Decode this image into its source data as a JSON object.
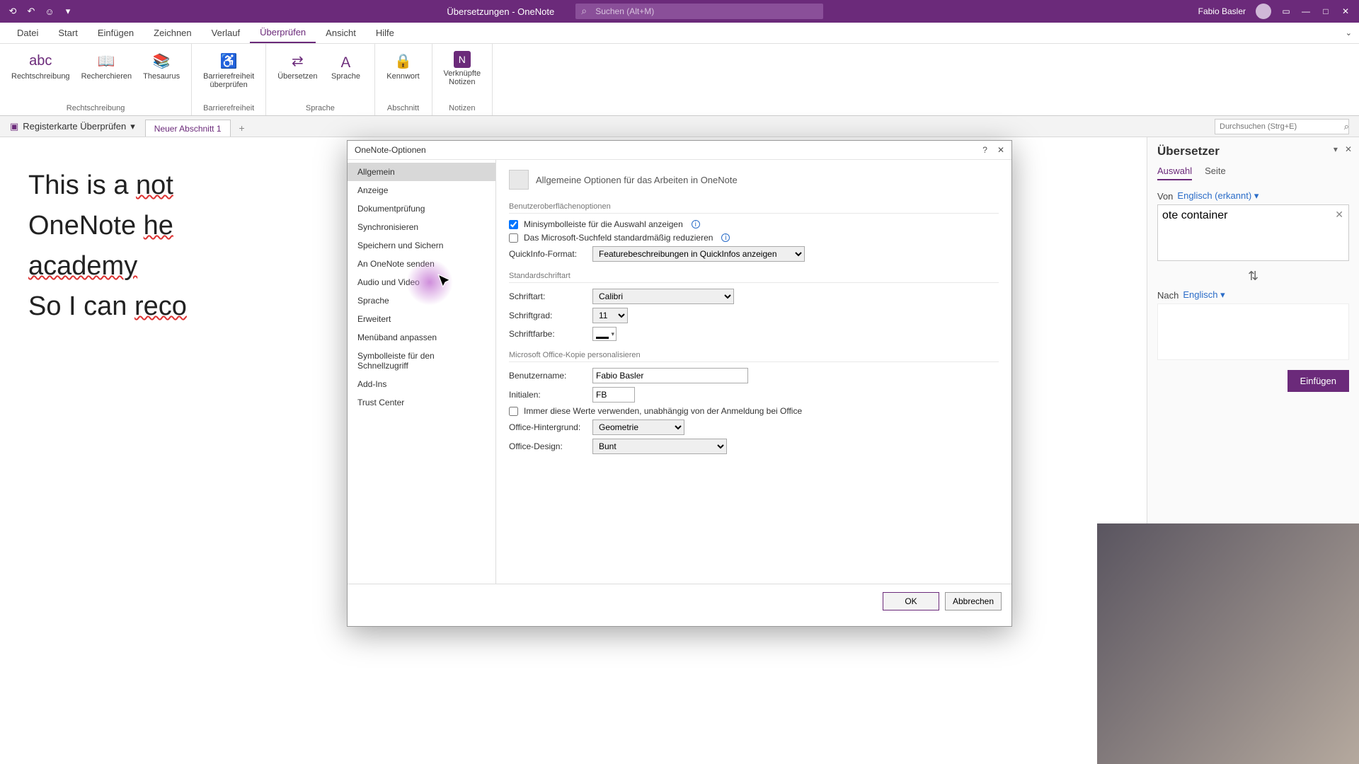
{
  "titlebar": {
    "title": "Übersetzungen - OneNote",
    "search_placeholder": "Suchen (Alt+M)",
    "user": "Fabio Basler"
  },
  "menu": {
    "items": [
      "Datei",
      "Start",
      "Einfügen",
      "Zeichnen",
      "Verlauf",
      "Überprüfen",
      "Ansicht",
      "Hilfe"
    ],
    "active_index": 5
  },
  "ribbon": {
    "groups": [
      {
        "name": "Rechtschreibung",
        "buttons": [
          "Rechtschreibung",
          "Recherchieren",
          "Thesaurus"
        ]
      },
      {
        "name": "Barrierefreiheit",
        "buttons": [
          "Barrierefreiheit\nüberprüfen"
        ]
      },
      {
        "name": "Sprache",
        "buttons": [
          "Übersetzen",
          "Sprache"
        ]
      },
      {
        "name": "Abschnitt",
        "buttons": [
          "Kennwort"
        ]
      },
      {
        "name": "Notizen",
        "buttons": [
          "Verknüpfte\nNotizen"
        ]
      }
    ]
  },
  "notebook": {
    "name": "Registerkarte Überprüfen",
    "tab": "Neuer Abschnitt 1",
    "search_pages": "Durchsuchen (Strg+E)"
  },
  "canvas": {
    "lines": [
      {
        "plain": "This is a ",
        "err": "not"
      },
      {
        "plain": "OneNote ",
        "err": "he"
      },
      {
        "plain": "",
        "err": "academy"
      },
      {
        "plain": "So I can ",
        "err": "reco"
      }
    ]
  },
  "dialog": {
    "title": "OneNote-Optionen",
    "nav": [
      "Allgemein",
      "Anzeige",
      "Dokumentprüfung",
      "Synchronisieren",
      "Speichern und Sichern",
      "An OneNote senden",
      "Audio und Video",
      "Sprache",
      "Erweitert",
      "Menüband anpassen",
      "Symbolleiste für den Schnellzugriff",
      "Add-Ins",
      "Trust Center"
    ],
    "nav_selected": 0,
    "heading": "Allgemeine Optionen für das Arbeiten in OneNote",
    "sec1": "Benutzeroberflächenoptionen",
    "cb1": "Minisymbolleiste für die Auswahl anzeigen",
    "cb2": "Das Microsoft-Suchfeld standardmäßig reduzieren",
    "quickinfo_label": "QuickInfo-Format:",
    "quickinfo_value": "Featurebeschreibungen in QuickInfos anzeigen",
    "sec2": "Standardschriftart",
    "font_label": "Schriftart:",
    "font_value": "Calibri",
    "size_label": "Schriftgrad:",
    "size_value": "11",
    "color_label": "Schriftfarbe:",
    "sec3": "Microsoft Office-Kopie personalisieren",
    "user_label": "Benutzername:",
    "user_value": "Fabio Basler",
    "init_label": "Initialen:",
    "init_value": "FB",
    "cb3": "Immer diese Werte verwenden, unabhängig von der Anmeldung bei Office",
    "bg_label": "Office-Hintergrund:",
    "bg_value": "Geometrie",
    "design_label": "Office-Design:",
    "design_value": "Bunt",
    "ok": "OK",
    "cancel": "Abbrechen"
  },
  "translator": {
    "title": "Übersetzer",
    "tabs": [
      "Auswahl",
      "Seite"
    ],
    "from_label": "Von",
    "from_lang": "Englisch (erkannt)",
    "text": "ote container",
    "to_label": "Nach",
    "to_lang": "Englisch",
    "insert": "Einfügen"
  }
}
